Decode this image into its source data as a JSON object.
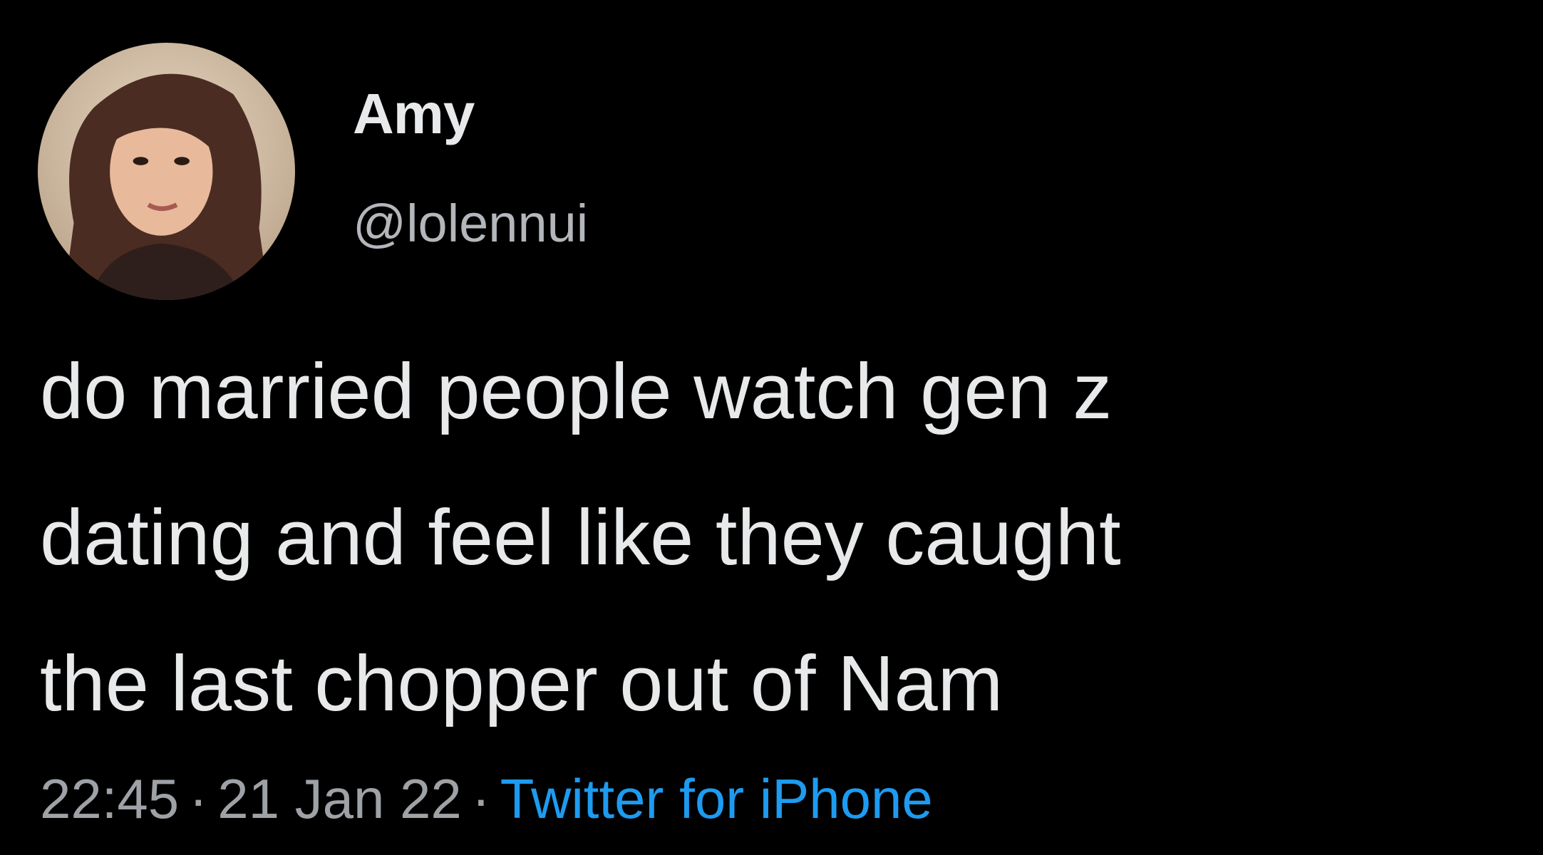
{
  "tweet": {
    "author": {
      "display_name": "Amy",
      "handle": "@lolennui"
    },
    "text_lines": [
      "do married people watch gen z",
      "dating and feel like they caught",
      "the last chopper out of Nam"
    ],
    "time": "22:45",
    "date": "21 Jan 22",
    "separator": "·",
    "source": "Twitter for iPhone"
  },
  "colors": {
    "background": "#000000",
    "primary_text": "#e7e9ea",
    "secondary_text": "#9ea2a6",
    "link": "#1d9bf0"
  }
}
